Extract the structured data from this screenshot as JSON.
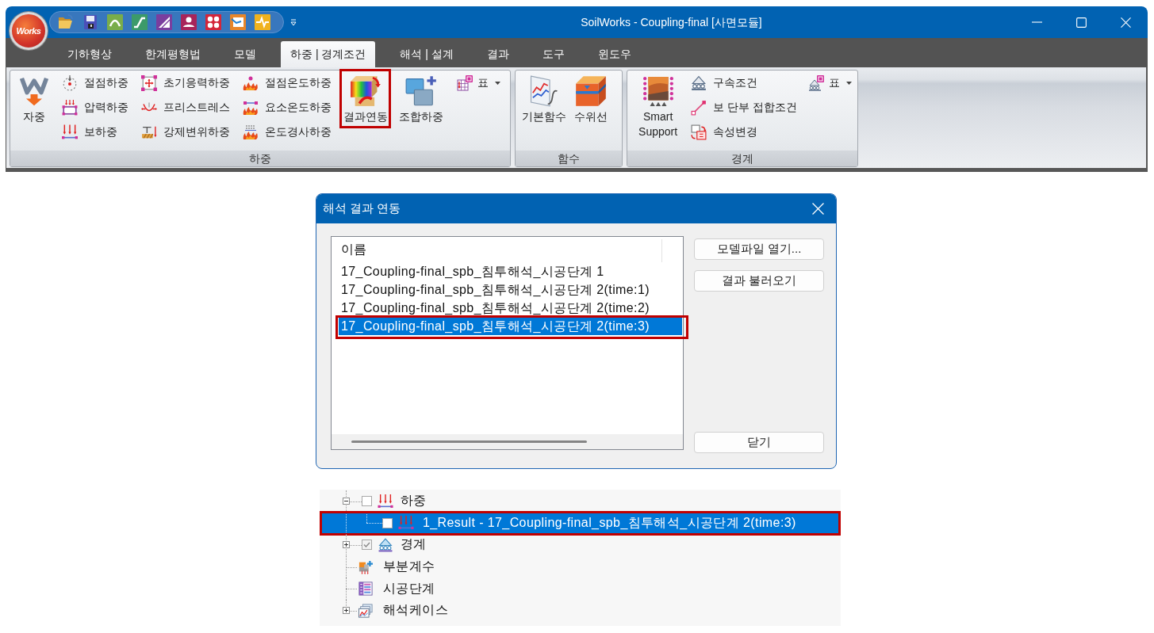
{
  "window": {
    "logo_text": "Works",
    "title": "SoilWorks - Coupling-final [사면모듈]"
  },
  "tabs": [
    {
      "label": "기하형상",
      "selected": false
    },
    {
      "label": "한계평형법",
      "selected": false
    },
    {
      "label": "모델",
      "selected": false
    },
    {
      "label": "하중 | 경계조건",
      "selected": true
    },
    {
      "label": "해석 | 설계",
      "selected": false
    },
    {
      "label": "결과",
      "selected": false
    },
    {
      "label": "도구",
      "selected": false
    },
    {
      "label": "윈도우",
      "selected": false
    }
  ],
  "ribbon": {
    "groups": [
      {
        "label": "하중",
        "items": [
          {
            "kind": "large",
            "label": "자중",
            "callout": false
          },
          {
            "kind": "column",
            "entries": [
              "절점하중",
              "압력하중",
              "보하중"
            ]
          },
          {
            "kind": "column",
            "entries": [
              "초기응력하중",
              "프리스트레스",
              "강제변위하중"
            ]
          },
          {
            "kind": "column",
            "entries": [
              "절점온도하중",
              "요소온도하중",
              "온도경사하중"
            ]
          },
          {
            "kind": "large",
            "label": "결과연동",
            "callout": true
          },
          {
            "kind": "large",
            "label": "조합하중",
            "callout": false
          },
          {
            "kind": "menu",
            "label": "표"
          }
        ]
      },
      {
        "label": "함수",
        "items": [
          {
            "kind": "large",
            "label": "기본함수",
            "callout": false
          },
          {
            "kind": "large",
            "label": "수위선",
            "callout": false
          }
        ]
      },
      {
        "label": "경계",
        "items": [
          {
            "kind": "large",
            "label": "Smart Support",
            "callout": false
          },
          {
            "kind": "column",
            "entries": [
              "구속조건",
              "보 단부 접합조건",
              "속성변경"
            ]
          },
          {
            "kind": "menu",
            "label": "표"
          }
        ]
      }
    ]
  },
  "dialog": {
    "title": "해석 결과 연동",
    "list": {
      "header": "이름",
      "items": [
        {
          "label": "17_Coupling-final_spb_침투해석_시공단계 1",
          "selected": false,
          "callout": false
        },
        {
          "label": "17_Coupling-final_spb_침투해석_시공단계 2(time:1)",
          "selected": false,
          "callout": false
        },
        {
          "label": "17_Coupling-final_spb_침투해석_시공단계 2(time:2)",
          "selected": false,
          "callout": false
        },
        {
          "label": "17_Coupling-final_spb_침투해석_시공단계 2(time:3)",
          "selected": true,
          "callout": true
        }
      ]
    },
    "buttons": [
      "모델파일 열기...",
      "결과 불러오기",
      "닫기"
    ]
  },
  "tree": [
    {
      "kind": "checkable",
      "label": "하중",
      "expanded": true,
      "checked": false,
      "selected": false,
      "callout": false,
      "children": [
        {
          "kind": "checkable",
          "label": "1_Result - 17_Coupling-final_spb_침투해석_시공단계 2(time:3)",
          "checked": false,
          "selected": true,
          "callout": true
        }
      ]
    },
    {
      "kind": "checkable",
      "label": "경계",
      "expanded": false,
      "checked": true,
      "selected": false,
      "callout": false
    },
    {
      "kind": "plain",
      "label": "부분계수",
      "selected": false,
      "callout": false
    },
    {
      "kind": "plain",
      "label": "시공단계",
      "selected": false,
      "callout": false
    },
    {
      "kind": "plain",
      "label": "해석케이스",
      "expanded": false,
      "selected": false,
      "callout": false
    }
  ]
}
